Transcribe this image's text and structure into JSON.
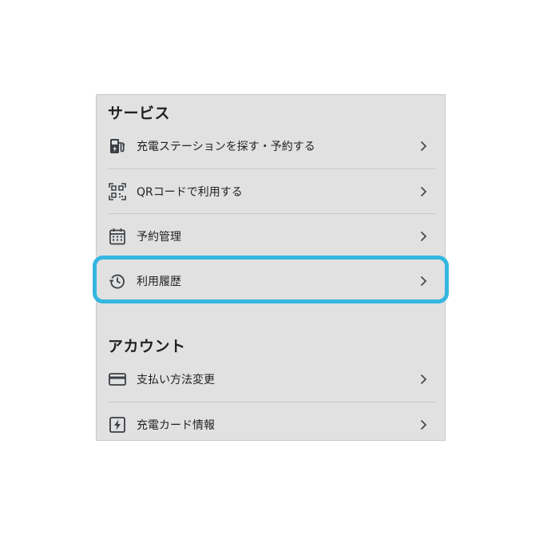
{
  "sections": {
    "service": {
      "title": "サービス",
      "items": [
        {
          "label": "充電ステーションを探す・予約する",
          "icon": "ev-station-icon"
        },
        {
          "label": "QRコードで利用する",
          "icon": "qr-code-icon"
        },
        {
          "label": "予約管理",
          "icon": "calendar-icon"
        },
        {
          "label": "利用履歴",
          "icon": "history-icon"
        }
      ]
    },
    "account": {
      "title": "アカウント",
      "items": [
        {
          "label": "支払い方法変更",
          "icon": "credit-card-icon"
        },
        {
          "label": "充電カード情報",
          "icon": "charge-card-icon"
        }
      ]
    }
  },
  "colors": {
    "panel_background": "#e1e1e1",
    "highlight": "#35b6e0",
    "icon": "#3a3f45"
  }
}
